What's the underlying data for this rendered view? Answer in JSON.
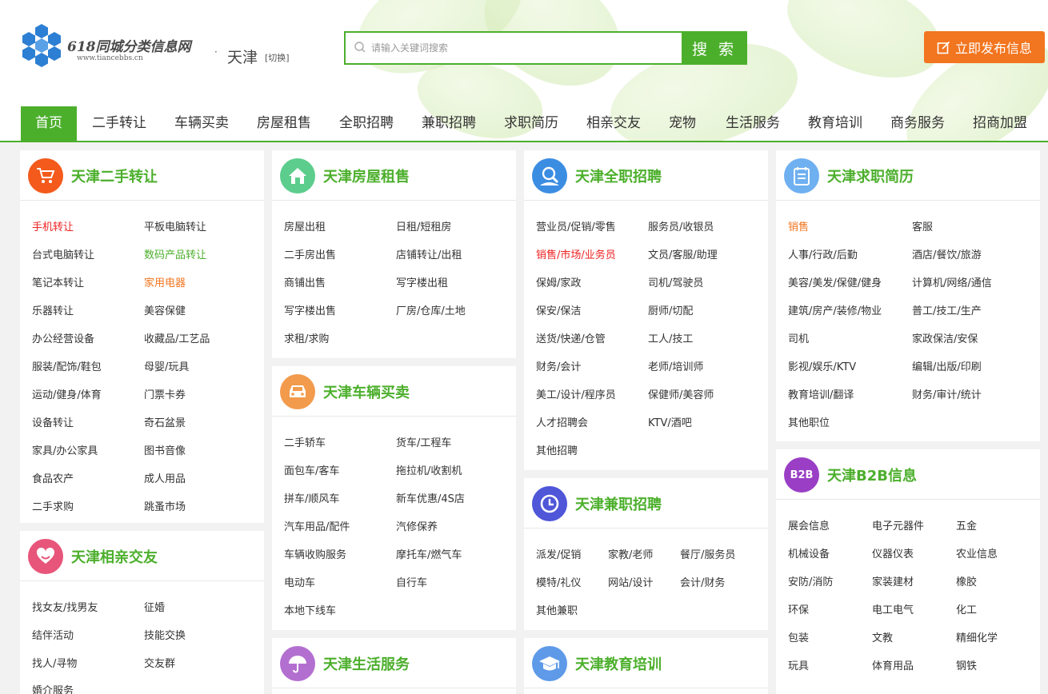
{
  "header": {
    "logo_text": "618同城分类信息网",
    "logo_sub": "www.tiancebbs.cn",
    "city_dot": "·",
    "city": "天津",
    "city_switch": "[切换]",
    "search_placeholder": "请输入关键词搜索",
    "search_button": "搜 索",
    "post_button": "立即发布信息"
  },
  "nav": [
    "首页",
    "二手转让",
    "车辆买卖",
    "房屋租售",
    "全职招聘",
    "兼职招聘",
    "求职简历",
    "相亲交友",
    "宠物",
    "生活服务",
    "教育培训",
    "商务服务",
    "招商加盟"
  ],
  "panels": {
    "ershou": {
      "title": "天津二手转让",
      "links": [
        "手机转让",
        "平板电脑转让",
        "台式电脑转让",
        "数码产品转让",
        "笔记本转让",
        "家用电器",
        "乐器转让",
        "美容保健",
        "办公经营设备",
        "收藏品/工艺品",
        "服装/配饰/鞋包",
        "母婴/玩具",
        "运动/健身/体育",
        "门票卡券",
        "设备转让",
        "奇石盆景",
        "家具/办公家具",
        "图书音像",
        "食品农产",
        "成人用品",
        "二手求购",
        "跳蚤市场"
      ]
    },
    "xiangqin": {
      "title": "天津相亲交友",
      "links": [
        "找女友/找男友",
        "征婚",
        "结伴活动",
        "技能交换",
        "找人/寻物",
        "交友群",
        "婚介服务"
      ]
    },
    "fangwu": {
      "title": "天津房屋租售",
      "links": [
        "房屋出租",
        "日租/短租房",
        "二手房出售",
        "店铺转让/出租",
        "商铺出售",
        "写字楼出租",
        "写字楼出售",
        "厂房/仓库/土地",
        "求租/求购"
      ]
    },
    "cheliang": {
      "title": "天津车辆买卖",
      "links": [
        "二手轿车",
        "货车/工程车",
        "面包车/客车",
        "拖拉机/收割机",
        "拼车/顺风车",
        "新车优惠/4S店",
        "汽车用品/配件",
        "汽修保养",
        "车辆收购服务",
        "摩托车/燃气车",
        "电动车",
        "自行车",
        "本地下线车"
      ]
    },
    "shenghuo": {
      "title": "天津生活服务"
    },
    "quanzhi": {
      "title": "天津全职招聘",
      "links": [
        "营业员/促销/零售",
        "服务员/收银员",
        "销售/市场/业务员",
        "文员/客服/助理",
        "保姆/家政",
        "司机/驾驶员",
        "保安/保洁",
        "厨师/切配",
        "送货/快递/仓管",
        "工人/技工",
        "财务/会计",
        "老师/培训师",
        "美工/设计/程序员",
        "保健师/美容师",
        "人才招聘会",
        "KTV/酒吧",
        "其他招聘"
      ]
    },
    "jianzhi": {
      "title": "天津兼职招聘",
      "links": [
        "派发/促销",
        "家教/老师",
        "餐厅/服务员",
        "模特/礼仪",
        "网站/设计",
        "会计/财务",
        "其他兼职"
      ]
    },
    "jiaoyu": {
      "title": "天津教育培训"
    },
    "qiuzhi": {
      "title": "天津求职简历",
      "links": [
        "销售",
        "客服",
        "人事/行政/后勤",
        "酒店/餐饮/旅游",
        "美容/美发/保健/健身",
        "计算机/网络/通信",
        "建筑/房产/装修/物业",
        "普工/技工/生产",
        "司机",
        "家政保洁/安保",
        "影视/娱乐/KTV",
        "编辑/出版/印刷",
        "教育培训/翻译",
        "财务/审计/统计",
        "其他职位"
      ]
    },
    "b2b": {
      "title": "天津B2B信息",
      "icon_text": "B2B",
      "links": [
        "展会信息",
        "电子元器件",
        "五金",
        "机械设备",
        "仪器仪表",
        "农业信息",
        "安防/消防",
        "家装建材",
        "橡胶",
        "环保",
        "电工电气",
        "化工",
        "包装",
        "文教",
        "精细化学",
        "玩具",
        "体育用品",
        "钢铁"
      ]
    }
  },
  "colors": {
    "green": "#4caf2c",
    "orange": "#f2751f",
    "red": "#e22"
  },
  "icons": [
    "cart-icon",
    "house-icon",
    "person-icon",
    "resume-icon",
    "heart-icon",
    "car-icon",
    "umbrella-icon",
    "clock-icon",
    "b2b-icon",
    "graduation-cap-icon",
    "search-icon",
    "edit-icon"
  ]
}
